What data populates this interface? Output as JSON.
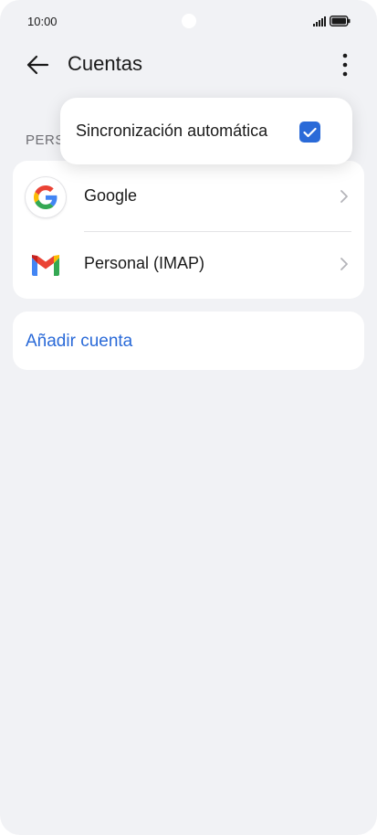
{
  "status_bar": {
    "time": "10:00",
    "signal_icon": "signal-icon",
    "battery_icon": "battery-icon"
  },
  "header": {
    "title": "Cuentas",
    "back_icon": "arrow-left-icon",
    "more_icon": "more-vertical-icon"
  },
  "section_label": "PERS",
  "accounts": [
    {
      "name": "Google",
      "icon": "google-icon"
    },
    {
      "name": "Personal (IMAP)",
      "icon": "gmail-icon"
    }
  ],
  "add_account_label": "Añadir cuenta",
  "popup_menu": {
    "items": [
      {
        "label": "Sincronización automática",
        "checked": true
      }
    ]
  },
  "colors": {
    "accent": "#2a6ad8",
    "background": "#f1f2f5",
    "card": "#ffffff",
    "text_primary": "#1a1a1a",
    "text_secondary": "#6f6f74"
  }
}
